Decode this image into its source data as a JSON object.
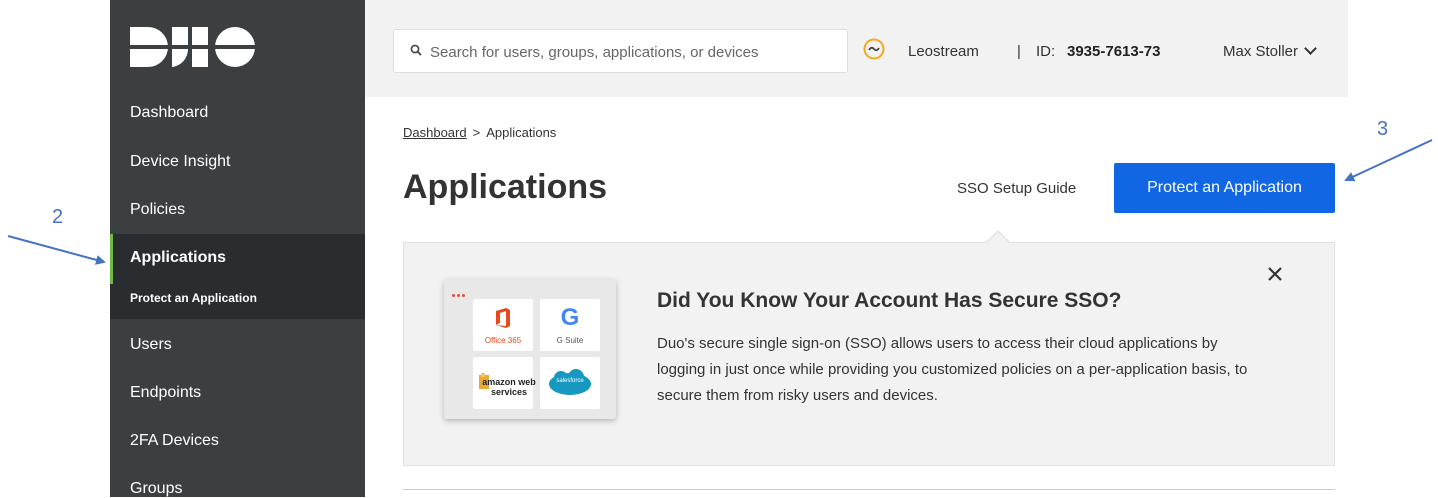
{
  "sidebar": {
    "logo_text": "DUO",
    "items": [
      {
        "label": "Dashboard"
      },
      {
        "label": "Device Insight"
      },
      {
        "label": "Policies"
      },
      {
        "label": "Applications"
      },
      {
        "label": "Protect an Application"
      },
      {
        "label": "Users"
      },
      {
        "label": "Endpoints"
      },
      {
        "label": "2FA Devices"
      },
      {
        "label": "Groups"
      }
    ],
    "active_item": "Applications",
    "active_accent": "#6dbb42",
    "bg_color": "#3b3f42"
  },
  "header": {
    "search_placeholder": "Search for users, groups, applications, or devices",
    "account_icon": "account-switch-icon",
    "account_name": "Leostream",
    "separator": "|",
    "id_label": "ID:",
    "id_value": "3935-7613-73",
    "user_name": "Max Stoller"
  },
  "breadcrumb": {
    "home": "Dashboard",
    "separator": ">",
    "current": "Applications"
  },
  "page": {
    "title": "Applications",
    "sso_guide": "SSO Setup Guide",
    "protect_button": "Protect an Application",
    "primary_color": "#1166e4"
  },
  "callout": {
    "title": "Did You Know Your Account Has Secure SSO?",
    "body": "Duo's secure single sign-on (SSO) allows users to access their cloud applications by logging in just once while providing you customized policies on a per-application basis, to secure them from risky users and devices.",
    "tiles": [
      {
        "label": "Office 365",
        "icon": "office365-icon"
      },
      {
        "label": "G Suite",
        "icon": "google-icon"
      },
      {
        "label": "amazon web services",
        "icon": "aws-icon"
      },
      {
        "label": "salesforce",
        "icon": "salesforce-icon"
      }
    ]
  },
  "annotations": [
    {
      "label": "2"
    },
    {
      "label": "3"
    }
  ]
}
